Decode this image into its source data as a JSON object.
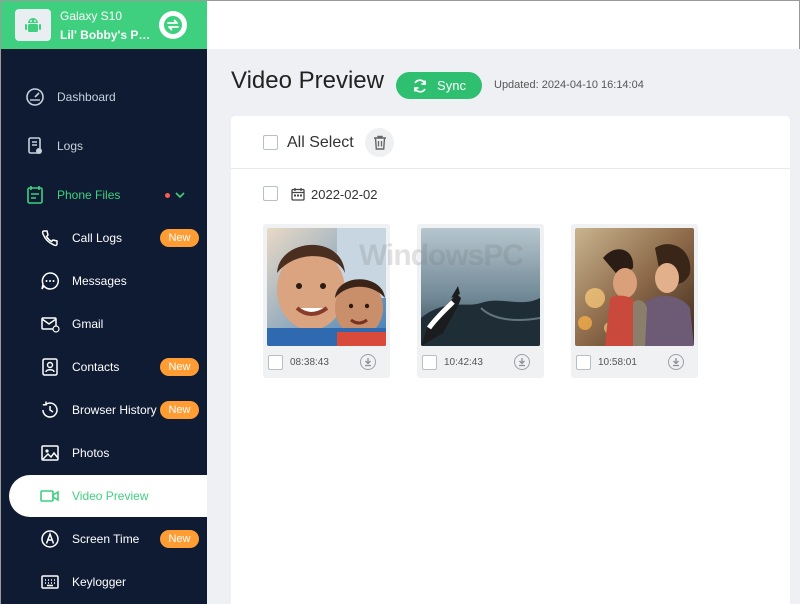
{
  "device": {
    "name": "Galaxy S10",
    "owner": "Lil' Bobby's Pho..."
  },
  "sidebar": {
    "items": [
      {
        "label": "Dashboard",
        "icon": "speedometer-icon"
      },
      {
        "label": "Logs",
        "icon": "logs-icon"
      },
      {
        "label": "Phone Files",
        "icon": "phone-files-icon"
      },
      {
        "label": "Call Logs",
        "icon": "phone-icon",
        "badge": "New"
      },
      {
        "label": "Messages",
        "icon": "chat-icon"
      },
      {
        "label": "Gmail",
        "icon": "mail-icon"
      },
      {
        "label": "Contacts",
        "icon": "contacts-icon",
        "badge": "New"
      },
      {
        "label": "Browser History",
        "icon": "history-icon",
        "badge": "New"
      },
      {
        "label": "Photos",
        "icon": "photo-icon"
      },
      {
        "label": "Video Preview",
        "icon": "video-icon"
      },
      {
        "label": "Screen Time",
        "icon": "screen-time-icon",
        "badge": "New"
      },
      {
        "label": "Keylogger",
        "icon": "keyboard-icon"
      }
    ]
  },
  "main": {
    "title": "Video Preview",
    "sync_label": "Sync",
    "updated": "Updated: 2024-04-10 16:14:04",
    "all_select_label": "All Select",
    "group_date": "2022-02-02",
    "videos": [
      {
        "time": "08:38:43",
        "subject": "two smiling boys"
      },
      {
        "time": "10:42:43",
        "subject": "whale in water"
      },
      {
        "time": "10:58:01",
        "subject": "friends laughing outdoors"
      }
    ]
  },
  "watermark": "WindowsPC",
  "colors": {
    "sidebar_bg": "#0f1b33",
    "accent_green": "#3fd07f",
    "badge_orange": "#ff9c33",
    "main_bg": "#eef0f3"
  }
}
